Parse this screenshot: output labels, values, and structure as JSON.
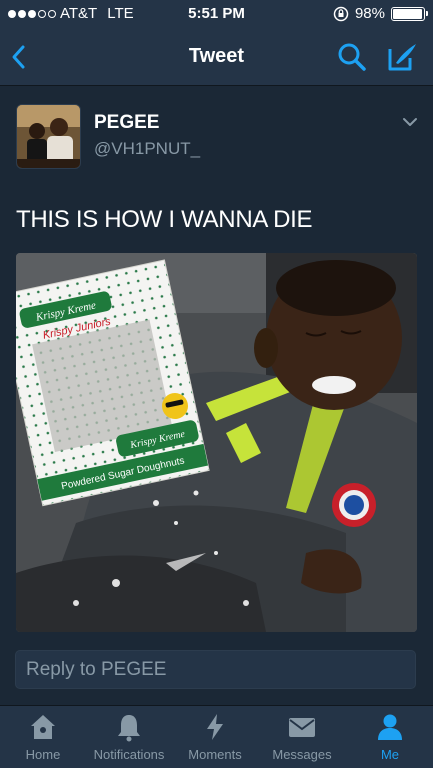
{
  "status_bar": {
    "carrier": "AT&T",
    "network": "LTE",
    "time": "5:51 PM",
    "battery": "98%",
    "battery_level": 0.98,
    "signal_bars": 3,
    "signal_total": 5
  },
  "nav": {
    "title": "Tweet"
  },
  "tweet": {
    "author_name": "PEGEE",
    "author_handle": "@VH1PNUT_",
    "text": "THIS IS HOW I WANNA DIE",
    "media": {
      "bag_brand": "Krispy Kreme",
      "bag_text_1": "Krispy Juniors",
      "bag_text_2": "Powdered Sugar Doughnuts"
    }
  },
  "reply": {
    "placeholder": "Reply to PEGEE"
  },
  "tab_bar": {
    "tabs": [
      {
        "label": "Home",
        "icon": "home-icon",
        "active": false
      },
      {
        "label": "Notifications",
        "icon": "bell-icon",
        "active": false
      },
      {
        "label": "Moments",
        "icon": "lightning-icon",
        "active": false
      },
      {
        "label": "Messages",
        "icon": "envelope-icon",
        "active": false
      },
      {
        "label": "Me",
        "icon": "person-icon",
        "active": true
      }
    ]
  },
  "colors": {
    "background": "#1b2836",
    "bar": "#243447",
    "accent": "#1da1f2",
    "muted": "#8899a6"
  }
}
